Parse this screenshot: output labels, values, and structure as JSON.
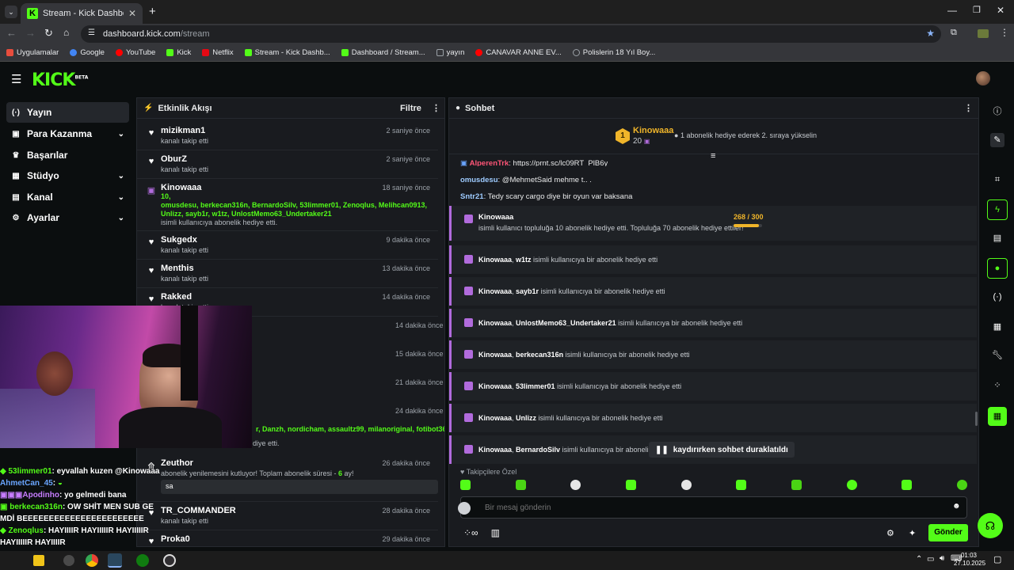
{
  "browser": {
    "tab_title": "Stream - Kick Dashboard",
    "url_host": "dashboard.kick.com",
    "url_path": "/stream",
    "bookmarks": [
      {
        "label": "Uygulamalar",
        "color": "#e84d3d"
      },
      {
        "label": "Google",
        "color": "#4285f4"
      },
      {
        "label": "YouTube",
        "color": "#ff0000"
      },
      {
        "label": "Kick",
        "color": "#53fc18"
      },
      {
        "label": "Netflix",
        "color": "#e50914"
      },
      {
        "label": "Stream - Kick Dashb...",
        "color": "#53fc18"
      },
      {
        "label": "Dashboard / Stream...",
        "color": "#53fc18"
      },
      {
        "label": "yayın",
        "color": "#9aa0a6"
      },
      {
        "label": "CANAVAR ANNE EV...",
        "color": "#ff0000"
      },
      {
        "label": "Polislerin 18 Yıl Boy...",
        "color": "#9aa0a6"
      }
    ]
  },
  "kick": {
    "logo": "KICK",
    "logo_sup": "BETA",
    "accent": "#53fc18"
  },
  "nav": [
    {
      "label": "Yayın",
      "icon": "broadcast-icon",
      "glyph": "((·))",
      "active": true,
      "chevron": false
    },
    {
      "label": "Para Kazanma",
      "icon": "money-icon",
      "glyph": "▣",
      "active": false,
      "chevron": true
    },
    {
      "label": "Başarılar",
      "icon": "trophy-icon",
      "glyph": "🏆",
      "active": false,
      "chevron": false
    },
    {
      "label": "Stüdyo",
      "icon": "studio-icon",
      "glyph": "▦",
      "active": false,
      "chevron": true
    },
    {
      "label": "Kanal",
      "icon": "channel-icon",
      "glyph": "▤",
      "active": false,
      "chevron": true
    },
    {
      "label": "Ayarlar",
      "icon": "settings-icon",
      "glyph": "⚙",
      "active": false,
      "chevron": true
    }
  ],
  "activity": {
    "title": "Etkinlik Akışı",
    "filter_label": "Filtre",
    "events": [
      {
        "name": "mizikman1",
        "sub": "kanalı takip etti",
        "time": "2 saniye önce",
        "icon": "heart"
      },
      {
        "name": "OburZ",
        "sub": "kanalı takip etti",
        "time": "2 saniye önce",
        "icon": "heart"
      },
      {
        "name": "Kinowaaa",
        "green": "10,\nomusdesu, berkecan316n, BernardoSilv, 53limmer01, Zenoqlus, Melihcan0913, Unlizz, sayb1r, w1tz, UnlostMemo63_Undertaker21",
        "sub": "isimli kullanıcıya abonelik hediye etti.",
        "time": "18 saniye önce",
        "icon": "gift"
      },
      {
        "name": "Sukgedx",
        "sub": "kanalı takip etti",
        "time": "9 dakika önce",
        "icon": "heart"
      },
      {
        "name": "Menthis",
        "sub": "kanalı takip etti",
        "time": "13 dakika önce",
        "icon": "heart"
      },
      {
        "name": "Rakked",
        "sub": "kanalı takip etti",
        "time": "14 dakika önce",
        "icon": "heart"
      }
    ],
    "hidden_times": [
      "14 dakika önce",
      "15 dakika önce",
      "21 dakika önce",
      "24 dakika önce"
    ],
    "partial_green": "r, Danzh, nordicham, assaultz99, milanoriginal, fotibot365,",
    "partial_sub": "diye etti.",
    "zeuthor": {
      "name": "Zeuthor",
      "sub": "abonelik yenilemesini kutluyor! Toplam abonelik süresi - ",
      "months": "6",
      "sub_end": " ay!",
      "message": "sa",
      "time": "26 dakika önce"
    },
    "tr_commander": {
      "name": "TR_COMMANDER",
      "sub": "kanalı takip etti",
      "time": "28 dakika önce"
    },
    "proka": {
      "name": "Proka0",
      "time": "29 dakika önce"
    }
  },
  "chat": {
    "title": "Sohbet",
    "leader_name": "Kinowaaa",
    "leader_rank": "1",
    "leader_count": "20",
    "leader_note": "1 abonelik hediye ederek 2. sıraya yükselin",
    "lines": [
      {
        "user": "AlperenTrk",
        "text": "https://prnt.sc/lc09RT_PlB6y",
        "color": "#ff5577"
      },
      {
        "user": "omusdesu",
        "text": "@MehmetSaid mehme t.. .",
        "color": "#9ecbff"
      },
      {
        "user": "Sntr21",
        "text": "Tedy scary cargo diye bir oyun var baksana",
        "color": "#9ecbff"
      }
    ],
    "big_gift": {
      "user": "Kinowaaa",
      "text": "isimli kullanıcı topluluğa 10 abonelik hediye etti. Topluluğa 70 abonelik hediye ettiler!",
      "progress": "268 / 300",
      "progress_value": 268,
      "progress_max": 300
    },
    "gifts": [
      {
        "from": "Kinowaaa",
        "to": "w1tz"
      },
      {
        "from": "Kinowaaa",
        "to": "sayb1r"
      },
      {
        "from": "Kinowaaa",
        "to": "UnlostMemo63_Undertaker21"
      },
      {
        "from": "Kinowaaa",
        "to": "berkecan316n"
      },
      {
        "from": "Kinowaaa",
        "to": "53limmer01"
      },
      {
        "from": "Kinowaaa",
        "to": "Unlizz"
      },
      {
        "from": "Kinowaaa",
        "to": "BernardoSilv"
      }
    ],
    "gift_suffix": " isimli kullanıcıya bir abonelik hediye etti",
    "paused_label": "kaydırırken sohbet duraklatıldı",
    "followers_only": "Takipçilere Özel",
    "input_placeholder": "Bir mesaj gönderin",
    "send_label": "Gönder"
  },
  "overlay_chat": [
    {
      "user": "53limmer01",
      "text": ": eyvallah kuzen @Kinowaaa",
      "color": "#53fc18"
    },
    {
      "user": "AhmetCan_45",
      "text": ":",
      "color": "#6aa5ff"
    },
    {
      "user": "Apodinho",
      "text": ": yo gelmedi bana",
      "color": "#c77dff"
    },
    {
      "user": "berkecan316n",
      "text": ": OW SHİT MEN SUB GEMDİ BEEEEEEEEEEEEEEEEEEEEEEE",
      "color": "#53fc18"
    },
    {
      "user": "Zenoqlus",
      "text": ": HAYIIIIR HAYIIIIIR HAYIIIIIR HAYIIIIIR HAYIIIIR",
      "color": "#53fc18"
    }
  ],
  "taskbar": {
    "time": "01:03",
    "date": "27.10.2025"
  }
}
